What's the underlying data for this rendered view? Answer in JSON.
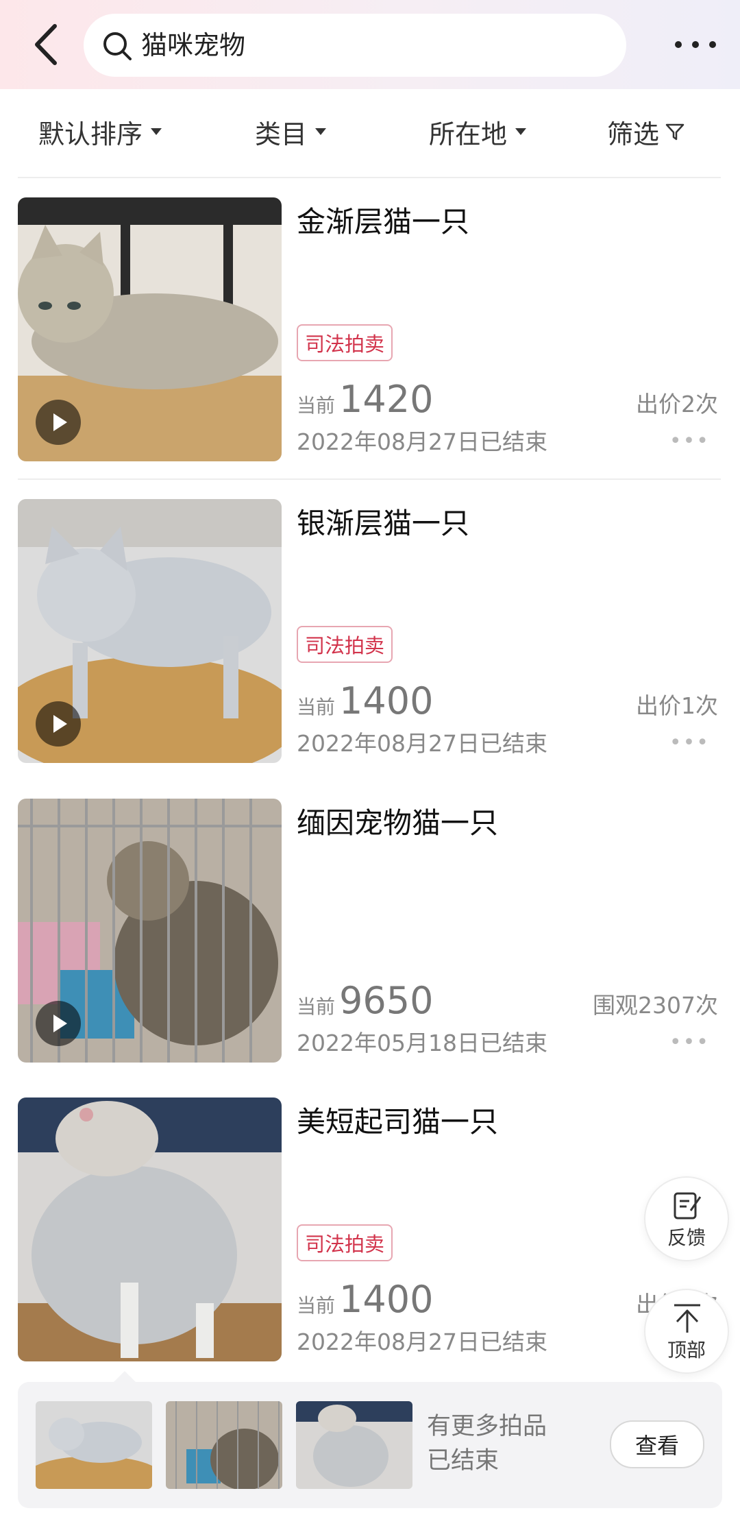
{
  "search": {
    "query": "猫咪宠物"
  },
  "filters": [
    {
      "label": "默认排序"
    },
    {
      "label": "类目"
    },
    {
      "label": "所在地"
    },
    {
      "label": "筛选"
    }
  ],
  "items": [
    {
      "title": "金渐层猫一只",
      "tag": "司法拍卖",
      "price_label": "当前",
      "price": "1420",
      "stat": "出价2次",
      "date": "2022年08月27日已结束"
    },
    {
      "title": "银渐层猫一只",
      "tag": "司法拍卖",
      "price_label": "当前",
      "price": "1400",
      "stat": "出价1次",
      "date": "2022年08月27日已结束"
    },
    {
      "title": "缅因宠物猫一只",
      "tag": "",
      "price_label": "当前",
      "price": "9650",
      "stat": "围观2307次",
      "date": "2022年05月18日已结束"
    },
    {
      "title": "美短起司猫一只",
      "tag": "司法拍卖",
      "price_label": "当前",
      "price": "1400",
      "stat": "出价1次",
      "date": "2022年08月27日已结束"
    }
  ],
  "floating": {
    "feedback_label": "反馈",
    "top_label": "顶部"
  },
  "banner": {
    "line1": "有更多拍品",
    "line2": "已结束",
    "view_label": "查看"
  },
  "colors": {
    "accent": "#d2334b",
    "tag_border": "#e7a6b1",
    "muted_text": "#888888"
  }
}
